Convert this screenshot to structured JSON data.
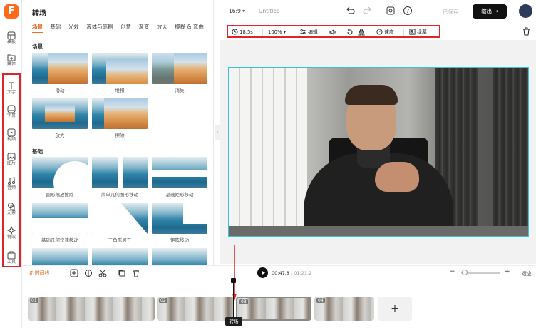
{
  "app": {
    "logo_letter": "F",
    "accent": "#ff6a1a",
    "highlight_color": "#e0242a"
  },
  "rail": {
    "items": [
      {
        "label": "模板",
        "icon": "template-icon"
      },
      {
        "label": "媒体",
        "icon": "media-upload-icon"
      },
      {
        "label": "文字",
        "icon": "text-icon"
      },
      {
        "label": "字幕",
        "icon": "subtitle-icon"
      },
      {
        "label": "视频",
        "icon": "video-icon"
      },
      {
        "label": "图片",
        "icon": "image-icon"
      },
      {
        "label": "音频",
        "icon": "audio-icon"
      },
      {
        "label": "元素",
        "icon": "elements-icon"
      },
      {
        "label": "特效",
        "icon": "effects-icon"
      },
      {
        "label": "工具",
        "icon": "tools-icon"
      }
    ]
  },
  "panel": {
    "title": "转场",
    "tabs": [
      "场景",
      "基础",
      "光效",
      "液体与笔刷",
      "创意",
      "渐变",
      "放大",
      "模糊 & 弯曲"
    ],
    "active_tab": "场景",
    "sections": [
      {
        "title": "场景",
        "items": [
          "滑动",
          "堆积",
          "消失",
          "放大",
          "擦除"
        ]
      },
      {
        "title": "基础",
        "items": [
          "圆形缩放擦除",
          "简单几何图形移动",
          "基础矩形移动",
          "基础几何快速移动",
          "三角形展开",
          "矩阵移动"
        ]
      }
    ]
  },
  "topbar": {
    "ratio": "16:9",
    "doc_title": "Untitled",
    "saved": "已保存",
    "export": "输出"
  },
  "toolbar": {
    "duration": "18.5s",
    "zoom": "100%",
    "edit": "编辑",
    "speed": "速度",
    "keyframe": "绿幕"
  },
  "timeline": {
    "mode": "时间线",
    "current_time": "00:47.8",
    "total_time": "01:21.2",
    "fit": "适应",
    "clips": [
      "01",
      "02",
      "03",
      "04"
    ],
    "tooltip": "转场"
  }
}
